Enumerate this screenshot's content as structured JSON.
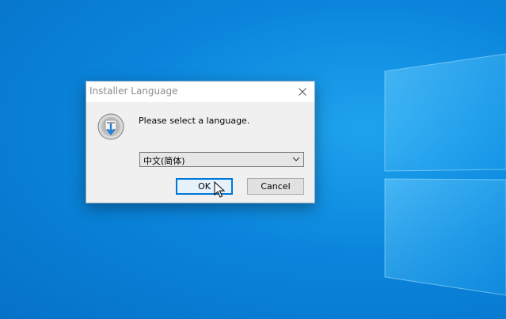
{
  "dialog": {
    "title": "Installer Language",
    "prompt": "Please select a language.",
    "language_select": {
      "value": "中文(简体)"
    },
    "ok_label": "OK",
    "cancel_label": "Cancel"
  },
  "icons": {
    "close": "close-icon",
    "app": "installer-icon",
    "chevron": "chevron-down-icon",
    "cursor": "mouse-cursor"
  },
  "colors": {
    "desktop_bg": "#0b86dc",
    "dialog_bg": "#f0f0f0",
    "focus_border": "#0078d7"
  }
}
